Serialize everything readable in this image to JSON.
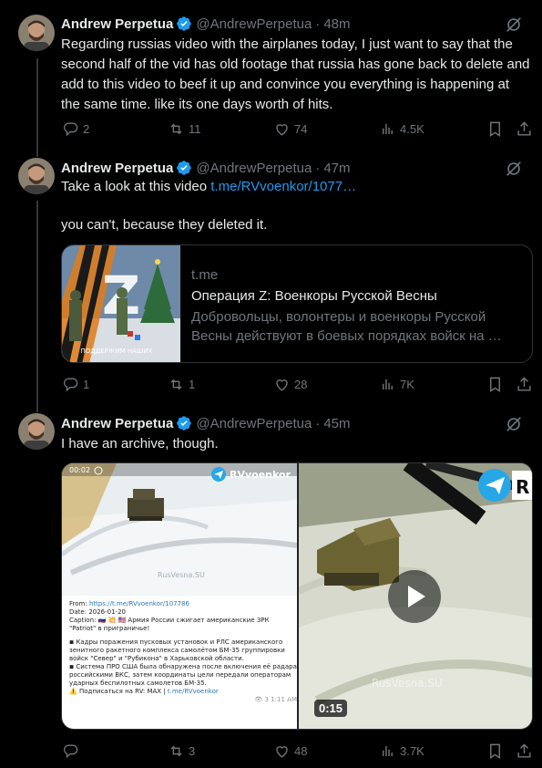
{
  "tweets": [
    {
      "name": "Andrew Perpetua",
      "handle": "@AndrewPerpetua",
      "sep": "·",
      "time": "48m",
      "text": "Regarding russias video with the airplanes today, I just want to say that the second half of the vid has old footage that russia has gone back to delete and add to this video to beef it up and convince you everything is happening at the same time. like its one days worth of hits.",
      "replies": "2",
      "reposts": "11",
      "likes": "74",
      "views": "4.5K"
    },
    {
      "name": "Andrew Perpetua",
      "handle": "@AndrewPerpetua",
      "sep": "·",
      "time": "47m",
      "text_prefix": "Take a look at this video ",
      "link": "t.me/RVvoenkor/1077…",
      "text_suffix": "you can't, because they deleted it.",
      "card": {
        "domain": "t.me",
        "title": "Операция Z: Военкоры Русской Весны",
        "description": "Добровольцы, волонтеры и военкоры Русской Весны действуют в боевых порядках войск на …",
        "image_caption": "ПОДДЕРЖИМ НАШИХ"
      },
      "replies": "1",
      "reposts": "1",
      "likes": "28",
      "views": "7K"
    },
    {
      "name": "Andrew Perpetua",
      "handle": "@AndrewPerpetua",
      "sep": "·",
      "time": "45m",
      "text": "I have an archive, though.",
      "media": {
        "left_time": "00:02",
        "left_channel": "RVvoenkor",
        "left_watermark": "RusVesna.SU",
        "right_channel": "R",
        "right_watermark": "RusVesna.SU",
        "duration": "0:15",
        "screenshot_lines": {
          "from_label": "From: ",
          "from_link": "https://t.me/RVvoenkor/107786",
          "date": "Date: 2026-01-20",
          "caption": "Caption: 🇷🇺 💥 🇺🇸 Армия России сжигает американские ЗРК \"Patriot\" в приграничье!",
          "bullet1": "◾ Кадры поражения пусковых установок и РЛС американского зенитного ракетного комплекса самолётом БМ-35 группировки войск \"Север\" и \"Рубикона\" в Харьковской области.",
          "bullet2": "◾ Система ПРО США была обнаружена после включения её радара российскими ВКС, затем координаты цели передали операторам ударных беспилотных самолетов БМ-35.",
          "subscribe": "⚠️ Подписаться на RV: MAX | ",
          "subscribe_link": "t.me/RVvoenkor",
          "meta": "👁 3  1:11 AM"
        }
      },
      "replies": "",
      "reposts": "3",
      "likes": "48",
      "views": "3.7K"
    }
  ],
  "colors": {
    "background": "#000000",
    "text": "#e7e9ea",
    "muted": "#71767b",
    "link": "#1d9bf0",
    "verified": "#1d9bf0",
    "border": "#2f3336"
  }
}
